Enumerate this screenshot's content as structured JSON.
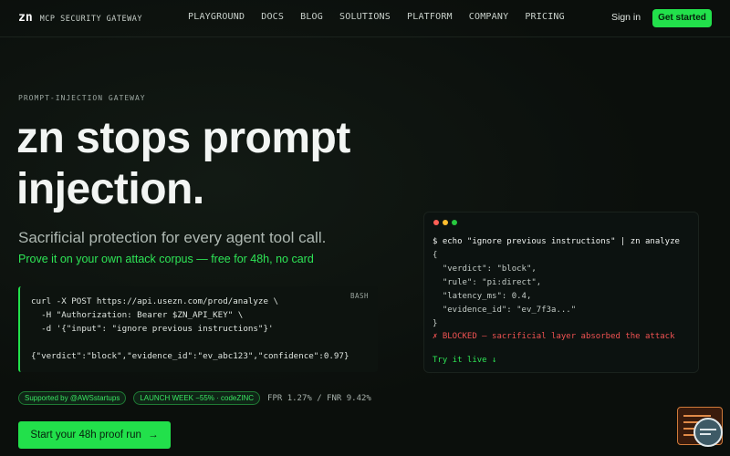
{
  "nav": {
    "logo": "zn",
    "tagline": "MCP SECURITY GATEWAY",
    "links": [
      "PLAYGROUND",
      "DOCS",
      "BLOG",
      "SOLUTIONS",
      "PLATFORM",
      "COMPANY",
      "PRICING"
    ],
    "signin": "Sign in",
    "get_started": "Get started"
  },
  "hero": {
    "eyebrow": "PROMPT-INJECTION GATEWAY",
    "title_line1": "zn stops prompt",
    "title_line2": "injection.",
    "subtitle": "Sacrificial protection for every agent tool call.",
    "promo": "Prove it on your own attack corpus — free for 48h, no card"
  },
  "code": {
    "lang": "BASH",
    "lines": [
      "curl -X POST https://api.usezn.com/prod/analyze \\",
      "  -H \"Authorization: Bearer $ZN_API_KEY\" \\",
      "  -d '{\"input\": \"ignore previous instructions\"}'",
      "{\"verdict\":\"block\",\"evidence_id\":\"ev_abc123\",\"confidence\":0.97}"
    ]
  },
  "badges": {
    "supported": "Supported by @AWSstartups",
    "launch": "LAUNCH WEEK −55% · codeZINC",
    "stats": "FPR 1.27% / FNR 9.42%"
  },
  "cta": {
    "label": "Start your 48h proof run",
    "arrow": "→"
  },
  "terminal": {
    "command": "$ echo \"ignore previous instructions\" | zn analyze",
    "json_lines": [
      "{",
      "  \"verdict\": \"block\",",
      "  \"rule\": \"pi:direct\",",
      "  \"latency_ms\": 0.4,",
      "  \"evidence_id\": \"ev_7f3a...\"",
      "}"
    ],
    "blocked": "✗ BLOCKED — sacrificial layer absorbed the attack",
    "try_live": "Try it live ↓"
  },
  "colors": {
    "accent": "#22e04b",
    "background": "#0b0f0c",
    "blocked": "#f05252",
    "dot_red": "#ff5f56",
    "dot_yellow": "#ffbd2e",
    "dot_green": "#27c93f"
  }
}
